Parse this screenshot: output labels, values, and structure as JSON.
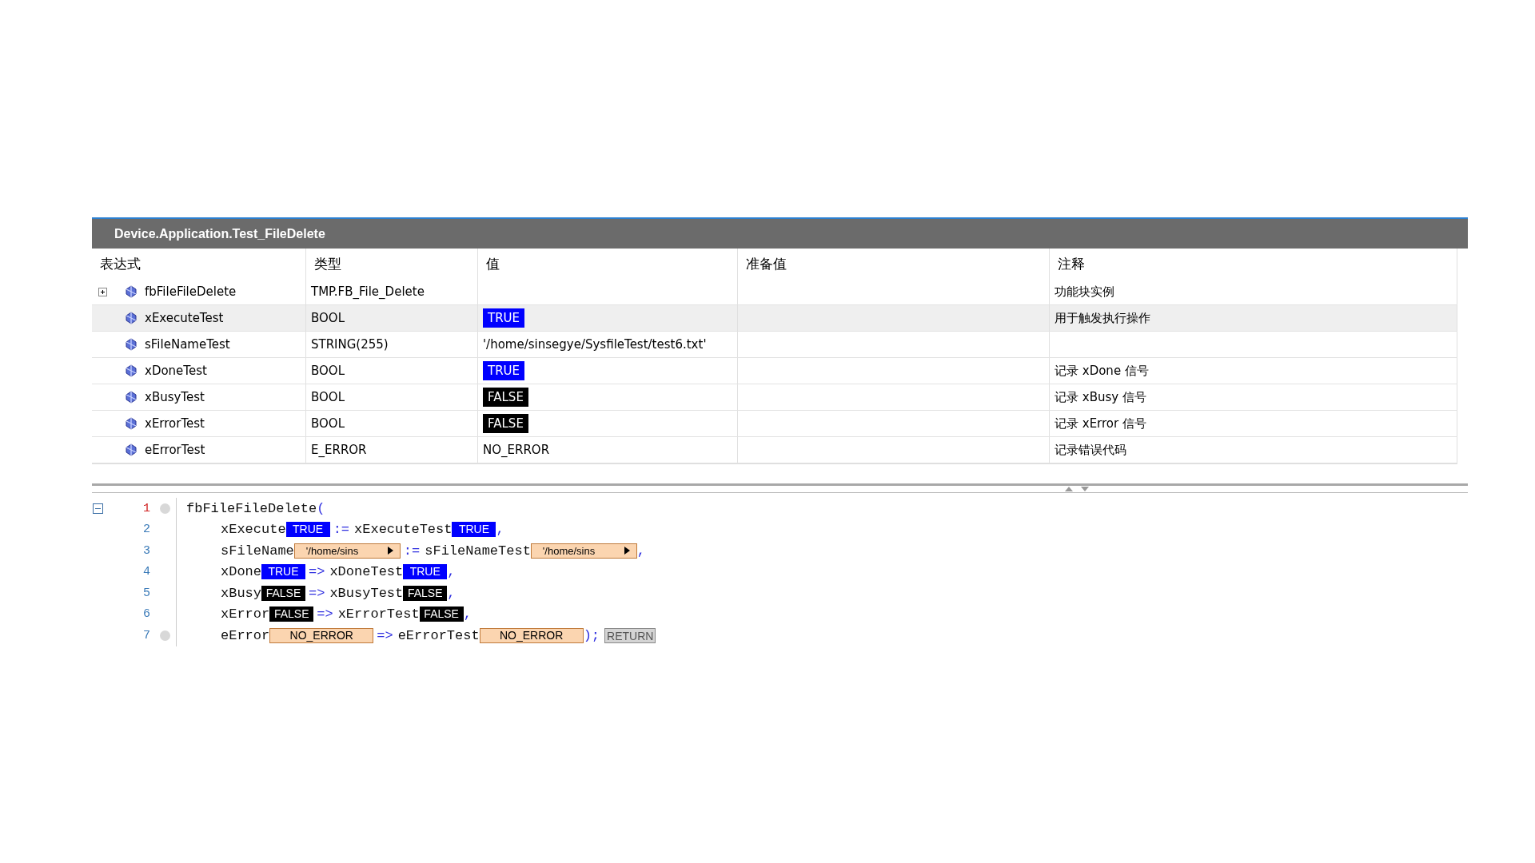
{
  "panel": {
    "title": "Device.Application.Test_FileDelete"
  },
  "table": {
    "columns": [
      "表达式",
      "类型",
      "值",
      "准备值",
      "注释"
    ],
    "rows": [
      {
        "expandable": true,
        "selected": false,
        "name": "fbFileFileDelete",
        "type": "TMP.FB_File_Delete",
        "comment": "功能块实例"
      },
      {
        "expandable": false,
        "selected": true,
        "name": "xExecuteTest",
        "type": "BOOL",
        "value": {
          "kind": "bool",
          "text": "TRUE",
          "on": true
        },
        "comment": "用于触发执行操作"
      },
      {
        "expandable": false,
        "selected": false,
        "name": "sFileNameTest",
        "type": "STRING(255)",
        "value": {
          "kind": "text",
          "text": "'/home/sinsegye/SysfileTest/test6.txt'"
        }
      },
      {
        "expandable": false,
        "selected": false,
        "name": "xDoneTest",
        "type": "BOOL",
        "value": {
          "kind": "bool",
          "text": "TRUE",
          "on": true
        },
        "comment": "记录 xDone 信号"
      },
      {
        "expandable": false,
        "selected": false,
        "name": "xBusyTest",
        "type": "BOOL",
        "value": {
          "kind": "bool",
          "text": "FALSE",
          "on": false
        },
        "comment": "记录 xBusy 信号"
      },
      {
        "expandable": false,
        "selected": false,
        "name": "xErrorTest",
        "type": "BOOL",
        "value": {
          "kind": "bool",
          "text": "FALSE",
          "on": false
        },
        "comment": "记录 xError 信号"
      },
      {
        "expandable": false,
        "selected": false,
        "name": "eErrorTest",
        "type": "E_ERROR",
        "value": {
          "kind": "text",
          "text": "NO_ERROR"
        },
        "comment": "记录错误代码"
      }
    ]
  },
  "code": {
    "lines": [
      {
        "number": "1",
        "current": true,
        "breakpoint": true,
        "fold": true,
        "indent": false,
        "segments": [
          {
            "kind": "code",
            "text": "fbFileFileDelete"
          },
          {
            "kind": "punct",
            "text": "("
          }
        ]
      },
      {
        "number": "2",
        "current": false,
        "breakpoint": false,
        "fold": false,
        "indent": true,
        "segments": [
          {
            "kind": "code",
            "text": "xExecute"
          },
          {
            "kind": "bool",
            "text": "TRUE",
            "on": true
          },
          {
            "kind": "op",
            "text": ":="
          },
          {
            "kind": "code",
            "text": "xExecuteTest"
          },
          {
            "kind": "bool",
            "text": "TRUE",
            "on": true
          },
          {
            "kind": "punct",
            "text": ","
          }
        ]
      },
      {
        "number": "3",
        "current": false,
        "breakpoint": false,
        "fold": false,
        "indent": true,
        "segments": [
          {
            "kind": "code",
            "text": "sFileName"
          },
          {
            "kind": "string",
            "text": "'/home/sins"
          },
          {
            "kind": "op",
            "text": ":="
          },
          {
            "kind": "code",
            "text": "sFileNameTest"
          },
          {
            "kind": "string",
            "text": "'/home/sins"
          },
          {
            "kind": "punct",
            "text": ","
          }
        ]
      },
      {
        "number": "4",
        "current": false,
        "breakpoint": false,
        "fold": false,
        "indent": true,
        "segments": [
          {
            "kind": "code",
            "text": "xDone"
          },
          {
            "kind": "bool",
            "text": "TRUE",
            "on": true
          },
          {
            "kind": "op",
            "text": "=>"
          },
          {
            "kind": "code",
            "text": "xDoneTest"
          },
          {
            "kind": "bool",
            "text": "TRUE",
            "on": true
          },
          {
            "kind": "punct",
            "text": ","
          }
        ]
      },
      {
        "number": "5",
        "current": false,
        "breakpoint": false,
        "fold": false,
        "indent": true,
        "segments": [
          {
            "kind": "code",
            "text": "xBusy"
          },
          {
            "kind": "bool",
            "text": "FALSE",
            "on": false
          },
          {
            "kind": "op",
            "text": "=>"
          },
          {
            "kind": "code",
            "text": "xBusyTest"
          },
          {
            "kind": "bool",
            "text": "FALSE",
            "on": false
          },
          {
            "kind": "punct",
            "text": ","
          }
        ]
      },
      {
        "number": "6",
        "current": false,
        "breakpoint": false,
        "fold": false,
        "indent": true,
        "segments": [
          {
            "kind": "code",
            "text": "xError"
          },
          {
            "kind": "bool",
            "text": "FALSE",
            "on": false
          },
          {
            "kind": "op",
            "text": "=>"
          },
          {
            "kind": "code",
            "text": "xErrorTest"
          },
          {
            "kind": "bool",
            "text": "FALSE",
            "on": false
          },
          {
            "kind": "punct",
            "text": ","
          }
        ]
      },
      {
        "number": "7",
        "current": false,
        "breakpoint": true,
        "fold": false,
        "indent": true,
        "segments": [
          {
            "kind": "code",
            "text": "eError"
          },
          {
            "kind": "enum",
            "text": "NO_ERROR"
          },
          {
            "kind": "op",
            "text": "=>"
          },
          {
            "kind": "code",
            "text": "eErrorTest"
          },
          {
            "kind": "enum",
            "text": "NO_ERROR"
          },
          {
            "kind": "punct",
            "text": ");"
          },
          {
            "kind": "return",
            "text": "RETURN"
          }
        ]
      }
    ]
  }
}
